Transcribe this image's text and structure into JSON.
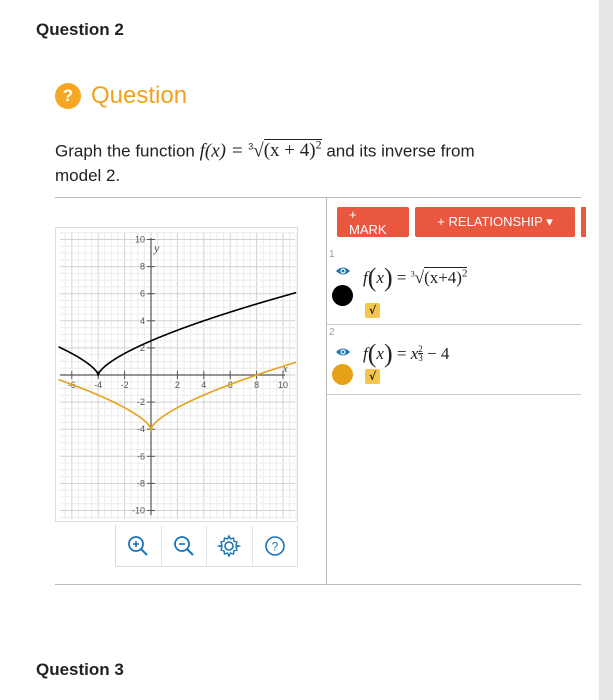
{
  "questions": {
    "current_heading": "Question 2",
    "next_heading": "Question 3"
  },
  "question": {
    "badge": "?",
    "label": "Question",
    "prompt_before": "Graph the function ",
    "prompt_fx": "f(x) = ",
    "prompt_index": "3",
    "prompt_radicand": "(x + 4)",
    "prompt_exp": "2",
    "prompt_after": " and its inverse from",
    "prompt_line2": "model 2."
  },
  "toolbar": {
    "mark_label": "+ MARK",
    "relationship_label": "+ RELATIONSHIP ▾"
  },
  "functions": [
    {
      "index": "1",
      "lhs_f": "f",
      "lhs_x": "x",
      "eq": "=",
      "root_index": "3",
      "rhs": "(x+4)",
      "rhs_exp": "2",
      "color": "#000000"
    },
    {
      "index": "2",
      "lhs_f": "f",
      "lhs_x": "x",
      "eq": "=",
      "base": "x",
      "exp_num": "2",
      "exp_den": "3",
      "tail": " − 4",
      "color": "#e6a118"
    }
  ],
  "colors": {
    "accent": "#e9573f",
    "badge": "#f5a623",
    "eye": "#1a74b8"
  },
  "icons": {
    "zoom_in": "zoom-in-icon",
    "zoom_out": "zoom-out-icon",
    "settings": "gear-icon",
    "help": "help-icon"
  },
  "graph": {
    "x_axis_label": "x",
    "y_axis_label": "y",
    "x_ticks": [
      "-6",
      "-4",
      "-2",
      "2",
      "4",
      "6",
      "8",
      "10"
    ],
    "y_ticks": [
      "10",
      "8",
      "6",
      "4",
      "2",
      "-2",
      "-4",
      "-6",
      "-8",
      "-10"
    ],
    "xlim": [
      -6.5,
      11
    ],
    "ylim": [
      -10.5,
      10.5
    ]
  }
}
